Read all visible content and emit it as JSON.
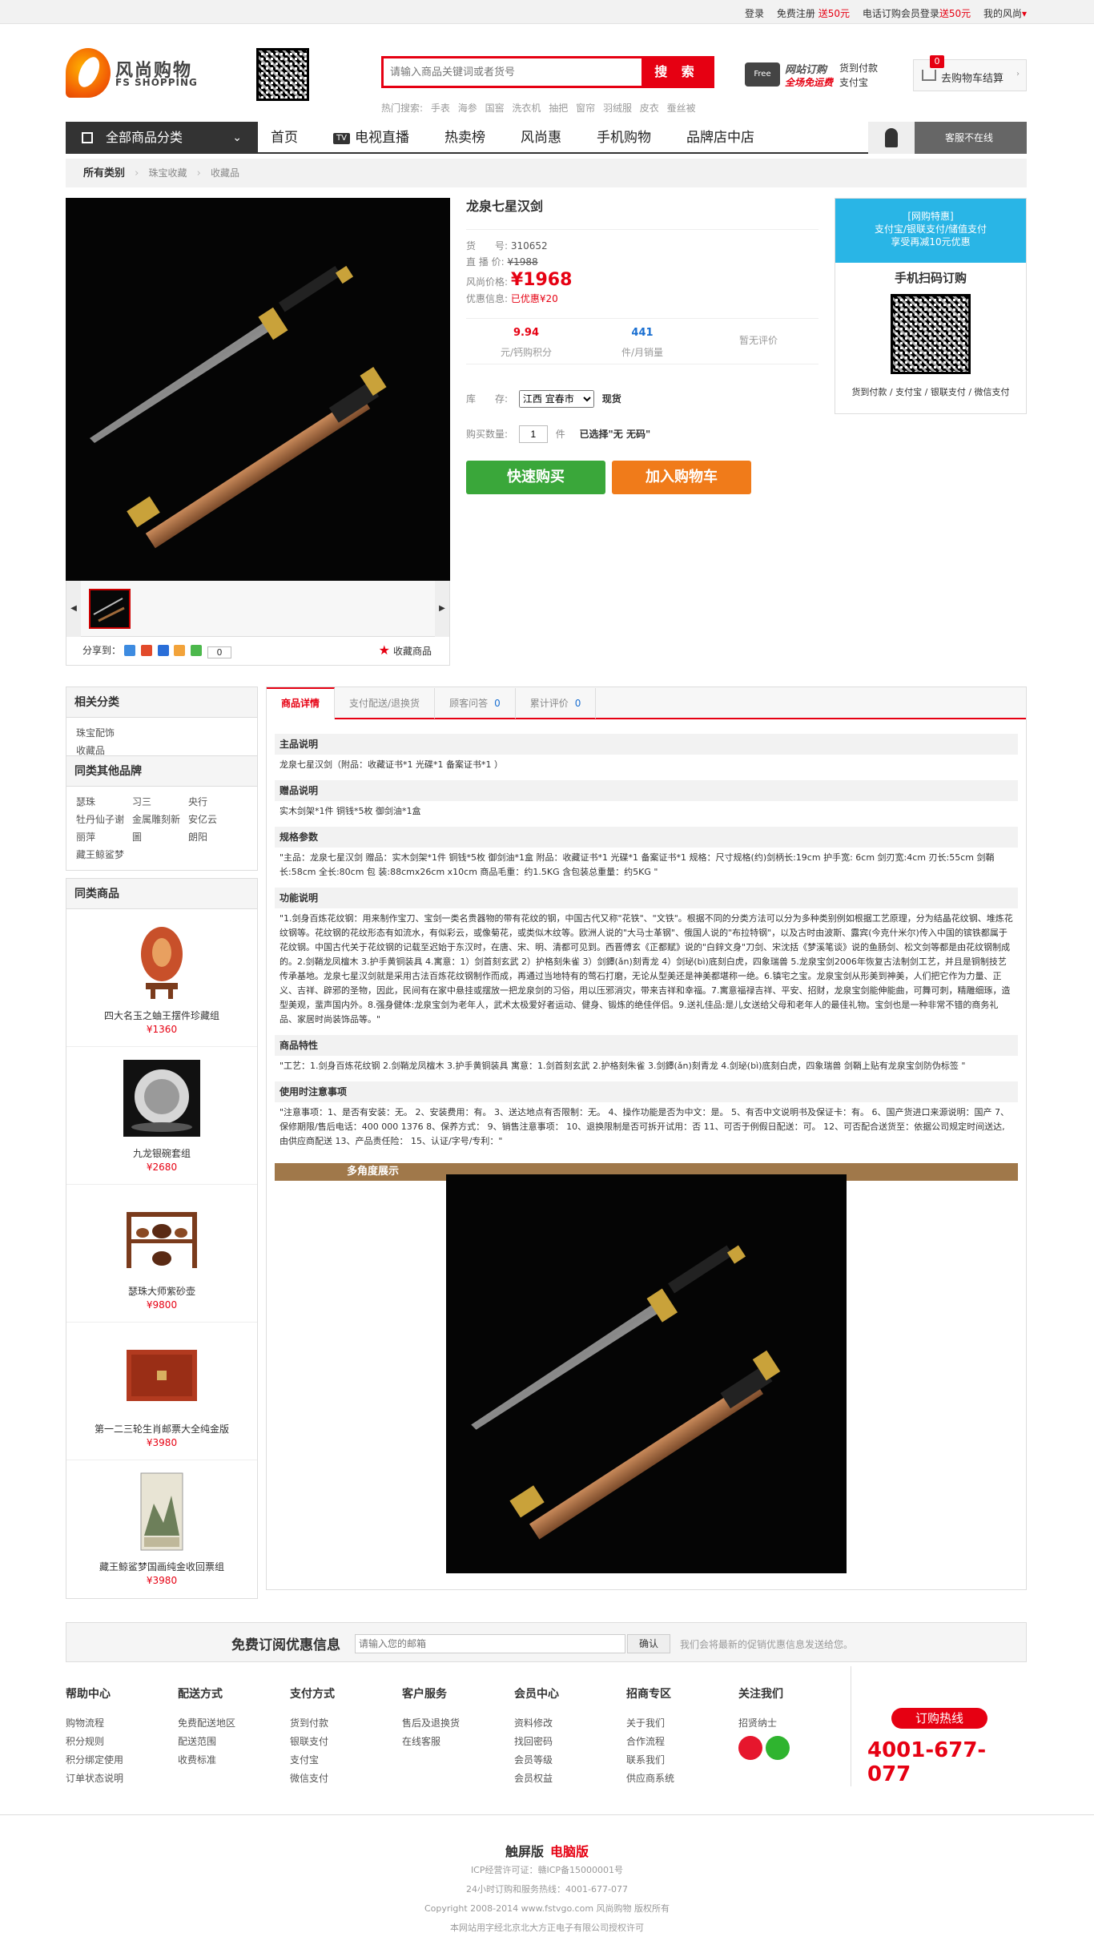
{
  "topbar": {
    "login": "登录",
    "register_prefix": "免费注册",
    "register_gift": "送50元",
    "phone_prefix": "电话订购会员登录",
    "phone_gift": "送50元",
    "my": "我的风尚",
    "my_arrow": "▾"
  },
  "logo": {
    "cn": "风尚购物",
    "en": "FS SHOPPING"
  },
  "search": {
    "placeholder": "请输入商品关键词或者货号",
    "button": "搜 索"
  },
  "hot": {
    "label": "热门搜索:",
    "terms": [
      "手表",
      "海参",
      "国窖",
      "洗衣机",
      "抽把",
      "窗帘",
      "羽绒服",
      "皮衣",
      "蚕丝被"
    ]
  },
  "promo": {
    "truck": "Free",
    "l1": "网站订购",
    "l2": "全场免运费",
    "r1": "货到付款",
    "r2": "支付宝"
  },
  "cart": {
    "count": "0",
    "label": "去购物车结算",
    "arrow": "›"
  },
  "nav": {
    "category": "全部商品分类",
    "category_arrow": "⌄",
    "tv_badge": "TV",
    "items": [
      "首页",
      "电视直播",
      "热卖榜",
      "风尚惠",
      "手机购物",
      "品牌店中店"
    ],
    "service": "客服不在线"
  },
  "breadcrumb": {
    "root": "所有类别",
    "sep": "›",
    "l1": "珠宝收藏",
    "l2": "收藏品"
  },
  "gallery": {
    "prev": "◀",
    "next": "▶"
  },
  "share": {
    "label": "分享到：",
    "count": "0",
    "fav_icon": "★",
    "fav": "收藏商品"
  },
  "product": {
    "title": "龙泉七星汉剑",
    "sku_label": "货　　号:",
    "sku": "310652",
    "live_label": "直 播 价:",
    "live_price": "¥1988",
    "fs_label": "风尚价格:",
    "fs_price": "¥1968",
    "discount_label": "优惠信息:",
    "discount": "已优惠¥20",
    "stats": [
      {
        "num": "9.94",
        "label": "元/钙购积分",
        "color": "#e60012"
      },
      {
        "num": "441",
        "label": "件/月销量",
        "color": "#1a6fd1"
      },
      {
        "num": "",
        "label": "暂无评价",
        "color": "#999"
      }
    ],
    "stock_label": "库　　存:",
    "stock_select": "江西 宜春市",
    "stock_state": "现货",
    "qty_label": "购买数量:",
    "qty": "1",
    "qty_unit": "件",
    "qty_selected": "已选择\"无 无码\"",
    "buy": "快速购买",
    "add_cart": "加入购物车"
  },
  "rpromo": {
    "line1": "[网购特惠]",
    "line2": "支付宝/银联支付/储值支付",
    "line3": "享受再减10元优惠",
    "scan_title": "手机扫码订购",
    "pay": "货到付款 / 支付宝 / 银联支付 / 微信支付"
  },
  "sidebar": {
    "related_title": "相关分类",
    "related": [
      "珠宝配饰",
      "收藏品"
    ],
    "brands_title": "同类其他品牌",
    "brands": [
      "瑟珠",
      "习三",
      "央行",
      "牡丹仙子谢",
      "金属雕刻新",
      "安亿云",
      "丽萍",
      "圖",
      "朗阳",
      "藏王鲸鲨梦"
    ],
    "similar_title": "同类商品",
    "similar": [
      {
        "name": "四大名玉之蚰王摆件珍藏组",
        "price": "¥1360",
        "color": "#c8502a"
      },
      {
        "name": "九龙银碗套组",
        "price": "¥2680",
        "color": "#bdbdbd"
      },
      {
        "name": "瑟珠大师紫砂壶",
        "price": "¥9800",
        "color": "#7a3b1c"
      },
      {
        "name": "第一二三轮生肖邮票大全纯金版",
        "price": "¥3980",
        "color": "#b23a1f"
      },
      {
        "name": "藏王鲸鲨梦国画纯金收回票组",
        "price": "¥3980",
        "color": "#6d7f5a"
      }
    ]
  },
  "details": {
    "tabs": [
      {
        "label": "商品详情",
        "count": ""
      },
      {
        "label": "支付配送/退换货",
        "count": ""
      },
      {
        "label": "顾客问答",
        "count": "0"
      },
      {
        "label": "累计评价",
        "count": "0"
      }
    ],
    "sections": [
      {
        "h": "主品说明",
        "t": "龙泉七星汉剑（附品：收藏证书*1 光碟*1 备案证书*1 ）"
      },
      {
        "h": "赠品说明",
        "t": "实木剑架*1件 铜钱*5枚 御剑油*1盒"
      },
      {
        "h": "规格参数",
        "t": "\"主品：龙泉七星汉剑 赠品：实木剑架*1件 铜钱*5枚 御剑油*1盒 附品：收藏证书*1 光碟*1 备案证书*1 规格：尺寸规格(约)剑柄长:19cm 护手宽: 6cm 剑刃宽:4cm 刃长:55cm 剑鞘长:58cm 全长:80cm 包 装:88cmx26cm x10cm 商品毛重：约1.5KG 含包装总重量：约5KG \""
      },
      {
        "h": "功能说明",
        "t": "\"1.剑身百炼花纹钢：用来制作宝刀、宝剑一类名贵器物的带有花纹的钢，中国古代又称\"花铁\"、\"文铁\"。根据不同的分类方法可以分为多种类别例如根据工艺原理，分为结晶花纹钢、堆炼花纹钢等。花纹钢的花纹形态有如流水，有似彩云，或像菊花，或类似木纹等。欧洲人说的\"大马士革钢\"、俄国人说的\"布拉特钢\"，以及古时由波斯、露宾(今克什米尔)传入中国的镔铁都属于花纹钢。中国古代关于花纹钢的记载至迟始于东汉时，在唐、宋、明、清都可见到。西晋傅玄《正都赋》说的\"白鋅文身\"刀剑、宋沈括《梦溪笔谈》说的鱼肠剑、松文剑等都是由花纹钢制成的。2.剑鞘龙凤檀木 3.护手黄铜装具 4.寓意：1）剑首刻玄武 2）护格刻朱雀 3）剑鐔(ǎn)刻青龙 4）剑珌(bì)底刻白虎，四象瑞兽 5.龙泉宝剑2006年恢复古法制剑工艺，并且是铜制技艺传承基地。龙泉七星汉剑就是采用古法百炼花纹钢制作而成，再通过当地特有的莺石打磨，无论从型美还是神美都堪称一绝。6.镇宅之宝。龙泉宝剑从形美到神美，人们把它作为力量、正义、吉祥、辟邪的圣物，因此，民间有在家中悬挂或摆放一把龙泉剑的习俗，用以压邪消灾，带来吉祥和幸福。7.寓意福禄吉祥、平安、招财，龙泉宝剑能伸能曲，可舞可刺，精雕细琢，造型美观，蜚声国内外。8.强身健体:龙泉宝剑为老年人，武术太极爱好者运动、健身、锻炼的绝佳伴侣。9.送礼佳品:是儿女送给父母和老年人的最佳礼物。宝剑也是一种非常不错的商务礼品、家居时尚装饰品等。\""
      },
      {
        "h": "商品特性",
        "t": "\"工艺：1.剑身百炼花纹钢 2.剑鞘龙凤檀木 3.护手黄铜装具 寓意：1.剑首刻玄武 2.护格刻朱雀 3.剑鐔(ǎn)刻青龙 4.剑珌(bì)底刻白虎，四象瑞兽 剑鞘上贴有龙泉宝剑防伪标签 \""
      },
      {
        "h": "使用时注意事项",
        "t": "\"注意事项：1、是否有安装：无。 2、安装费用：有。 3、送达地点有否限制：无。 4、操作功能是否为中文：是。 5、有否中文说明书及保证卡：有。 6、国产货进口来源说明：国产 7、保修期限/售后电话：400 000 1376 8、保养方式： 9、销售注意事项： 10、退换限制是否可拆开试用：否 11、可否于例假日配送：可。 12、可否配合送货至：依据公司规定时间送达,由供应商配送 13、产品责任险： 15、认证/字号/专利：\""
      }
    ],
    "multi_view": "多角度展示"
  },
  "subscribe": {
    "title": "免费订阅优惠信息",
    "placeholder": "请输入您的邮箱",
    "button": "确认",
    "note": "我们会将最新的促销优惠信息发送给您。"
  },
  "footer": {
    "cols": [
      {
        "h": "帮助中心",
        "items": [
          "购物流程",
          "积分规则",
          "积分绑定使用",
          "订单状态说明"
        ]
      },
      {
        "h": "配送方式",
        "items": [
          "免费配送地区",
          "配送范围",
          "收费标准"
        ]
      },
      {
        "h": "支付方式",
        "items": [
          "货到付款",
          "银联支付",
          "支付宝",
          "微信支付"
        ]
      },
      {
        "h": "客户服务",
        "items": [
          "售后及退换货",
          "在线客服"
        ]
      },
      {
        "h": "会员中心",
        "items": [
          "资料修改",
          "找回密码",
          "会员等级",
          "会员权益"
        ]
      },
      {
        "h": "招商专区",
        "items": [
          "关于我们",
          "合作流程",
          "联系我们",
          "供应商系统"
        ]
      },
      {
        "h": "关注我们",
        "items": [
          "招贤纳士"
        ]
      }
    ],
    "hotline_label": "订购热线",
    "hotline": "4001-677-077",
    "switch_touch": "触屏版",
    "switch_pc": "电脑版",
    "icp": "ICP经营许可证：赣ICP备15000001号",
    "service": "24小时订购和服务热线：4001-677-077",
    "copyright": "Copyright 2008-2014 www.fstvgo.com 风尚购物 版权所有",
    "auth": "本网站用字经北京北大方正电子有限公司授权许可"
  }
}
